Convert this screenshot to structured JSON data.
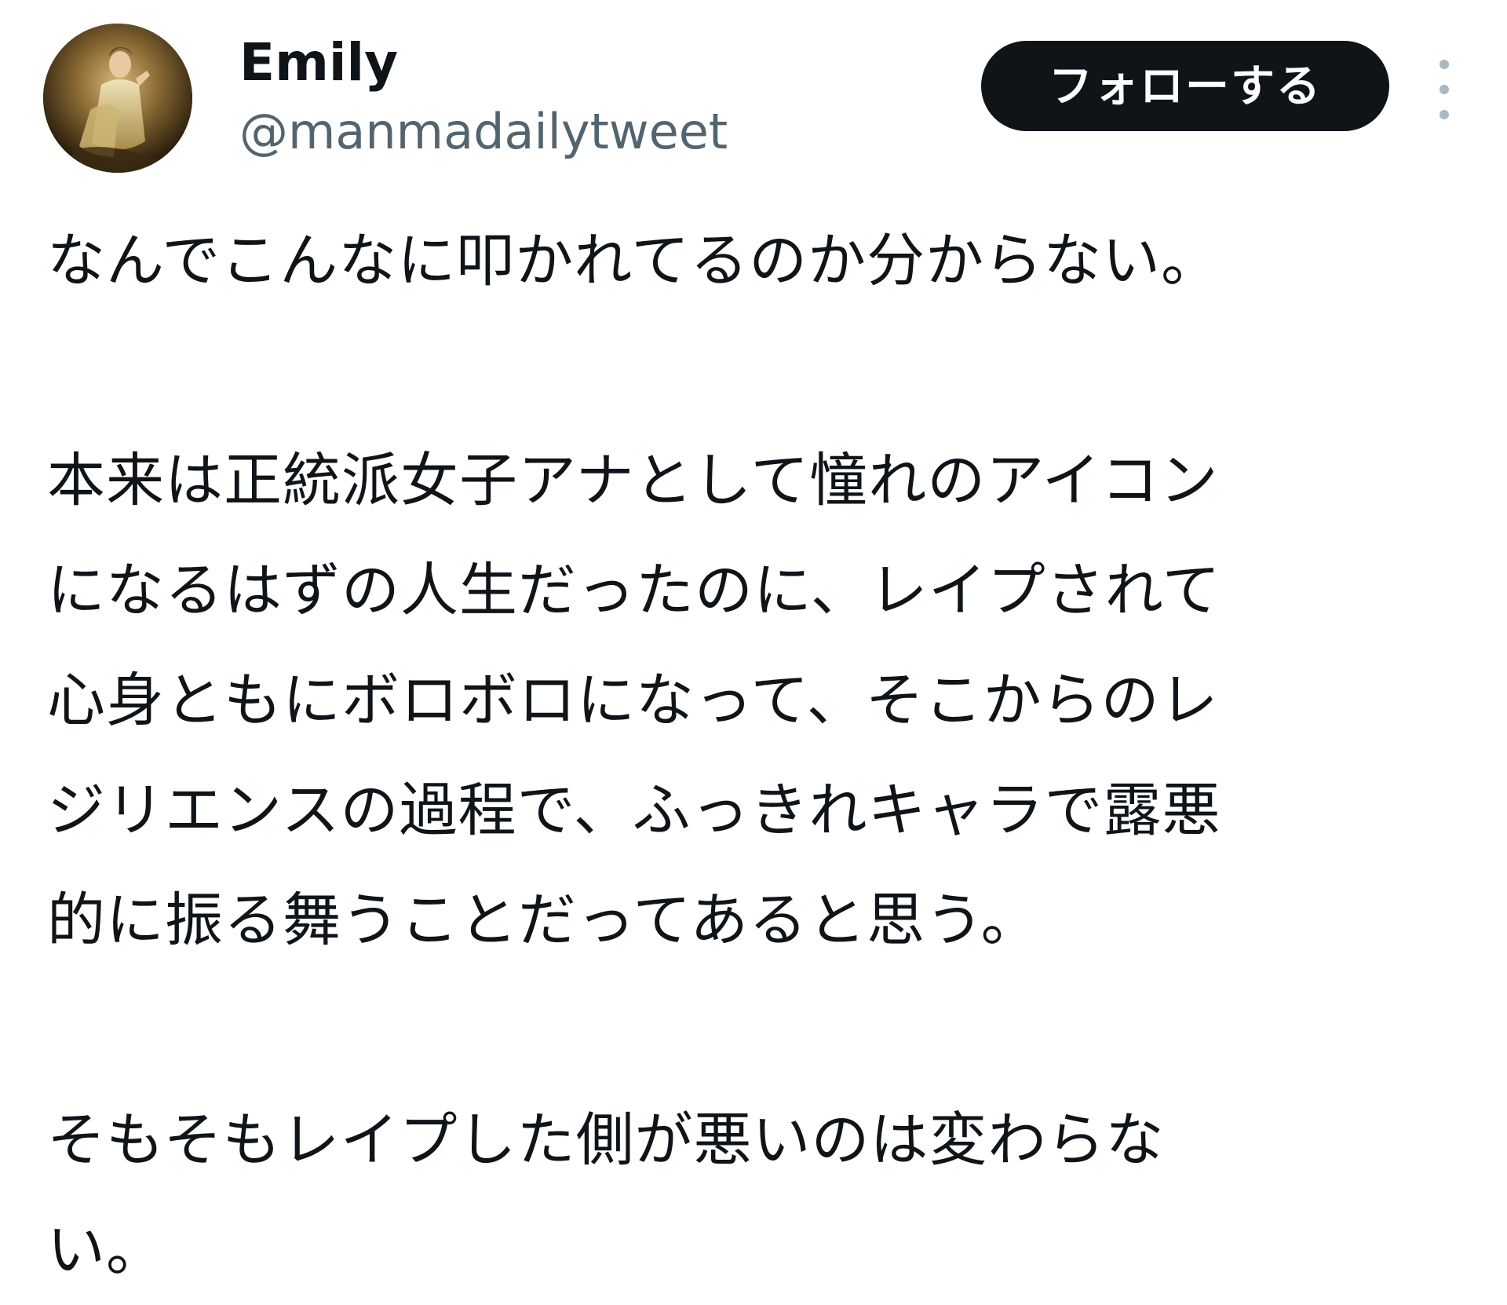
{
  "author": {
    "display_name": "Emily",
    "handle": "@manmadailytweet"
  },
  "actions": {
    "follow_label": "フォローする",
    "more_icon": "more-vertical-icon"
  },
  "tweet": {
    "lines": [
      "なんでこんなに叩かれてるのか分からない。",
      "",
      "本来は正統派女子アナとして憧れのアイコン",
      "になるはずの人生だったのに、レイプされて",
      "心身ともにボロボロになって、そこからのレ",
      "ジリエンスの過程で、ふっきれキャラで露悪",
      "的に振る舞うことだってあると思う。",
      "",
      "そもそもレイプした側が悪いのは変わらな",
      "い。"
    ]
  },
  "colors": {
    "text": "#0f1419",
    "secondary": "#536471",
    "button_bg": "#0f1419",
    "button_text": "#ffffff"
  }
}
